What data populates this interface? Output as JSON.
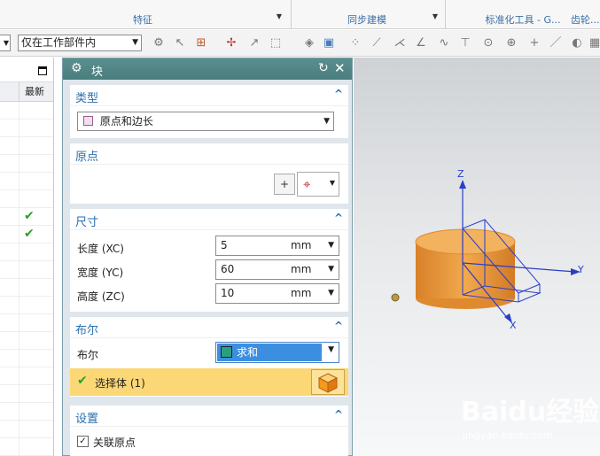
{
  "ribbon": {
    "groups": [
      {
        "label": "特征"
      },
      {
        "label": "同步建模"
      },
      {
        "label": "标准化工具 - G..."
      },
      {
        "label": "齿轮..."
      }
    ]
  },
  "toolbar": {
    "scope_select": "仅在工作部件内"
  },
  "navigator": {
    "column_header": "最新",
    "check_rows": [
      6,
      7
    ]
  },
  "dialog": {
    "title": "块",
    "type": {
      "header": "类型",
      "value": "原点和边长"
    },
    "origin": {
      "header": "原点"
    },
    "dimensions": {
      "header": "尺寸",
      "fields": [
        {
          "label": "长度 (XC)",
          "value": "5",
          "unit": "mm"
        },
        {
          "label": "宽度 (YC)",
          "value": "60",
          "unit": "mm"
        },
        {
          "label": "高度 (ZC)",
          "value": "10",
          "unit": "mm"
        }
      ]
    },
    "boolean": {
      "header": "布尔",
      "label": "布尔",
      "value": "求和",
      "select_body": "选择体 (1)"
    },
    "settings": {
      "header": "设置",
      "associate_origin": "关联原点"
    }
  },
  "viewport": {
    "axis_z": "Z",
    "axis_y": "Y",
    "axis_x": "X"
  },
  "watermark": {
    "brand": "Baidu经验",
    "url": "jingyan.baidu.com"
  }
}
